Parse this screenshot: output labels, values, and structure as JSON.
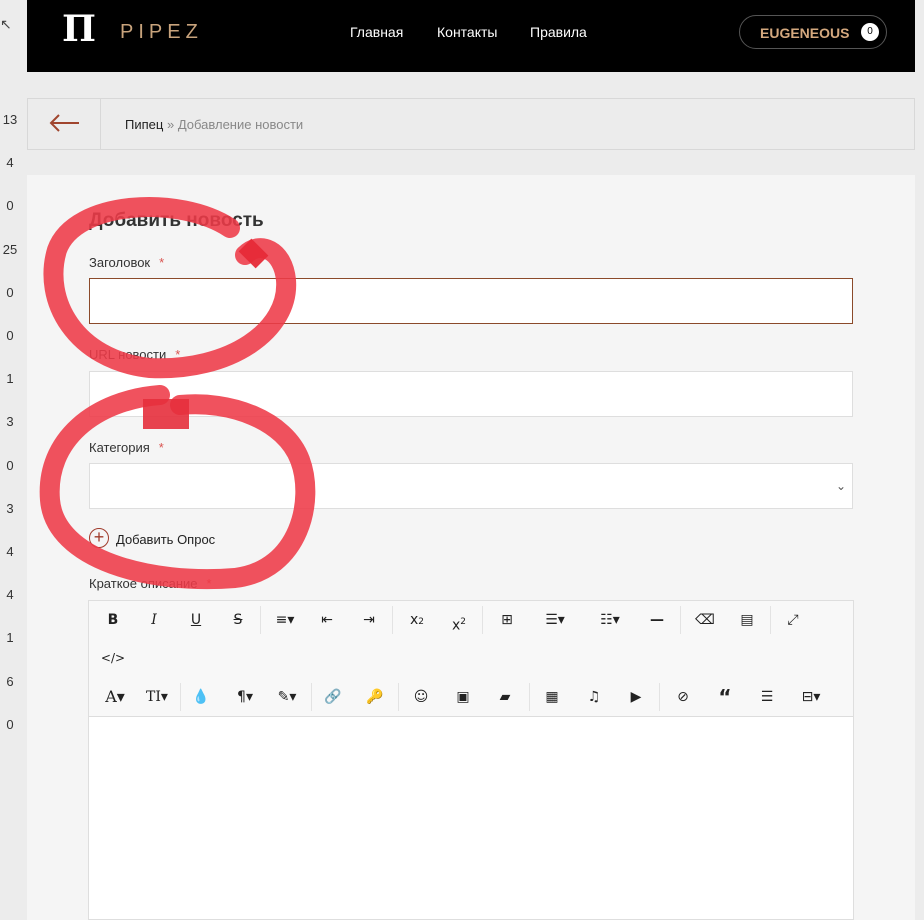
{
  "gutter": [
    "13",
    "4",
    "0",
    "25",
    "0",
    "0",
    "1",
    "3",
    "0",
    "3",
    "4",
    "4",
    "1",
    "6",
    "0"
  ],
  "header": {
    "logo_mark": "П",
    "logo_text": "PIPEZ",
    "nav": [
      "Главная",
      "Контакты",
      "Правила"
    ],
    "user": {
      "name": "EUGENEOUS",
      "count": "0"
    }
  },
  "breadcrumb": {
    "home": "Пипец",
    "separator": "»",
    "current": "Добавление новости"
  },
  "form": {
    "title": "Добавить новость",
    "fields": [
      {
        "label": "Заголовок",
        "required": "*",
        "value": ""
      },
      {
        "label": "URL новости",
        "required": "*",
        "value": ""
      },
      {
        "label": "Категория",
        "required": "*",
        "value": ""
      }
    ],
    "poll_label": "Добавить Опрос",
    "short_desc": {
      "label": "Краткое описание",
      "required": "*"
    }
  },
  "editor": {
    "row1": [
      "bold-icon",
      "italic-icon",
      "underline-icon",
      "strikethrough-icon",
      "align-icon",
      "outdent-icon",
      "indent-icon",
      "subscript-icon",
      "superscript-icon",
      "table-icon",
      "ordered-list-icon",
      "unordered-list-icon",
      "horizontal-rule-icon",
      "clear-format-icon",
      "paste-word-icon",
      "fullscreen-icon"
    ],
    "row2": [
      "code-view-icon"
    ],
    "row3": [
      "font-family-icon",
      "font-size-icon",
      "color-icon",
      "paragraph-icon",
      "style-icon",
      "link-icon",
      "key-icon",
      "emoji-icon",
      "image-icon",
      "file-manager-icon",
      "media-icon",
      "audio-icon",
      "video-icon",
      "hide-icon",
      "quote-icon",
      "spoiler-icon",
      "page-break-icon"
    ]
  },
  "colors": {
    "accent": "#c8a37c",
    "header_bg": "#000000",
    "focus_border": "#8b4a2a",
    "required": "#d9534f",
    "annotation": "#ee3a48"
  }
}
